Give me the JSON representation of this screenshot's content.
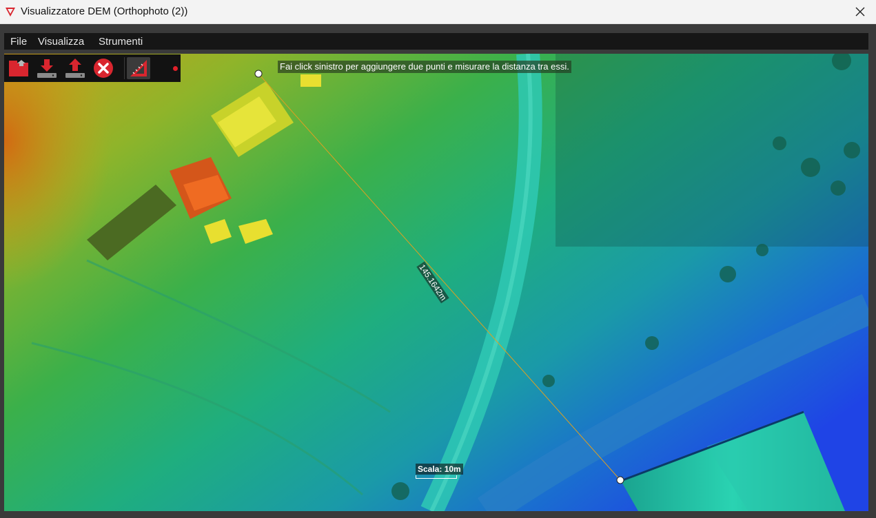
{
  "window": {
    "title": "Visualizzatore DEM (Orthophoto (2))",
    "close_icon": "close-icon",
    "app_icon": "app-logo-icon"
  },
  "menu": {
    "items": [
      {
        "label": "File"
      },
      {
        "label": "Visualizza"
      },
      {
        "label": "Strumenti"
      }
    ]
  },
  "toolbar": {
    "tools": [
      {
        "name": "open-folder-icon",
        "active": false
      },
      {
        "name": "download-icon",
        "active": false
      },
      {
        "name": "upload-icon",
        "active": false
      },
      {
        "name": "delete-icon",
        "active": false
      },
      {
        "name": "measure-ruler-icon",
        "active": true
      }
    ],
    "status_dot_color": "#e0202a"
  },
  "map": {
    "instruction": "Fai click sinistro per aggiungere due punti e misurare la distanza tra essi.",
    "measurement_label": "145.1642m",
    "scale_label": "Scala: 10m",
    "measure_line_color": "#e0a020"
  },
  "colors": {
    "accent_red": "#e0202a",
    "dem_high": "#c9a21a",
    "dem_mid": "#36b24c",
    "dem_low": "#1f4fe0"
  }
}
